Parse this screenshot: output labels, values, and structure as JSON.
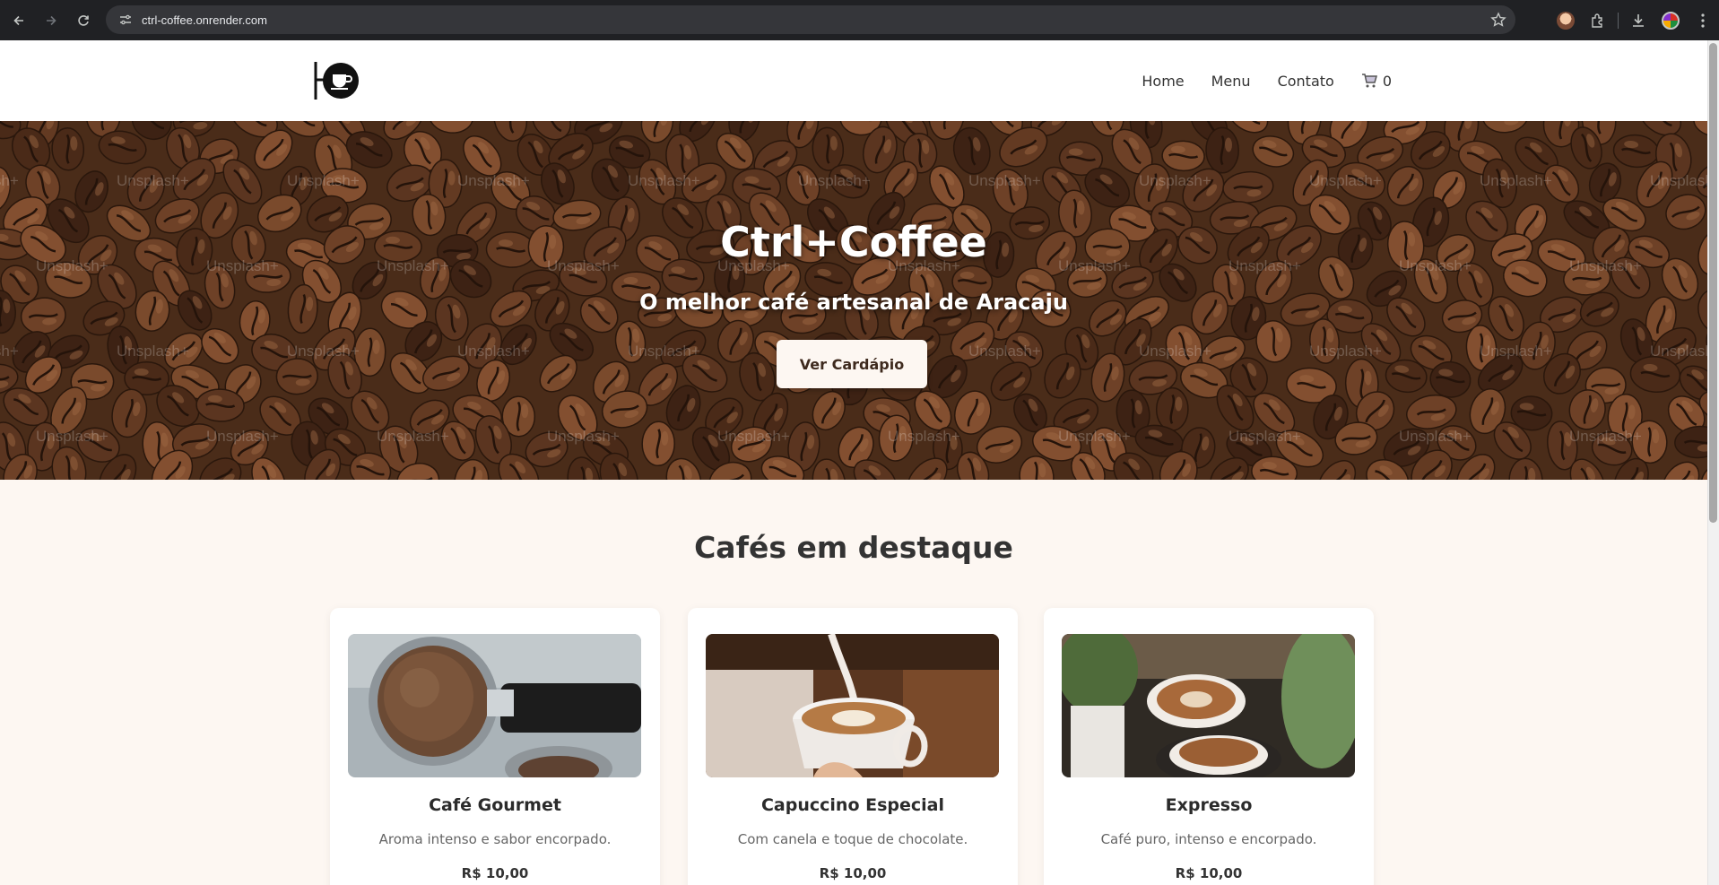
{
  "browser": {
    "url": "ctrl-coffee.onrender.com",
    "icons": [
      "back-icon",
      "forward-icon",
      "reload-icon",
      "site-settings-icon",
      "bookmark-star-icon",
      "extension-avatar-icon",
      "extensions-icon",
      "download-icon",
      "profile-avatar-icon",
      "more-menu-icon"
    ]
  },
  "site": {
    "nav": [
      {
        "label": "Home"
      },
      {
        "label": "Menu"
      },
      {
        "label": "Contato"
      }
    ],
    "cart_count": "0"
  },
  "hero": {
    "title": "Ctrl+Coffee",
    "subtitle": "O melhor café artesanal de Aracaju",
    "button": "Ver Cardápio",
    "watermark": "Unsplash+"
  },
  "featured": {
    "title": "Cafés em destaque",
    "items": [
      {
        "name": "Café Gourmet",
        "description": "Aroma intenso e sabor encorpado.",
        "price": "R$ 10,00"
      },
      {
        "name": "Capuccino Especial",
        "description": "Com canela e toque de chocolate.",
        "price": "R$ 10,00"
      },
      {
        "name": "Expresso",
        "description": "Café puro, intenso e encorpado.",
        "price": "R$ 10,00"
      }
    ]
  },
  "colors": {
    "chrome_bg": "#202124",
    "omnibox_bg": "#35363a",
    "page_bg": "#fdf7f2",
    "hero_button_bg": "#fdf7f2",
    "text_dark": "#333333"
  }
}
